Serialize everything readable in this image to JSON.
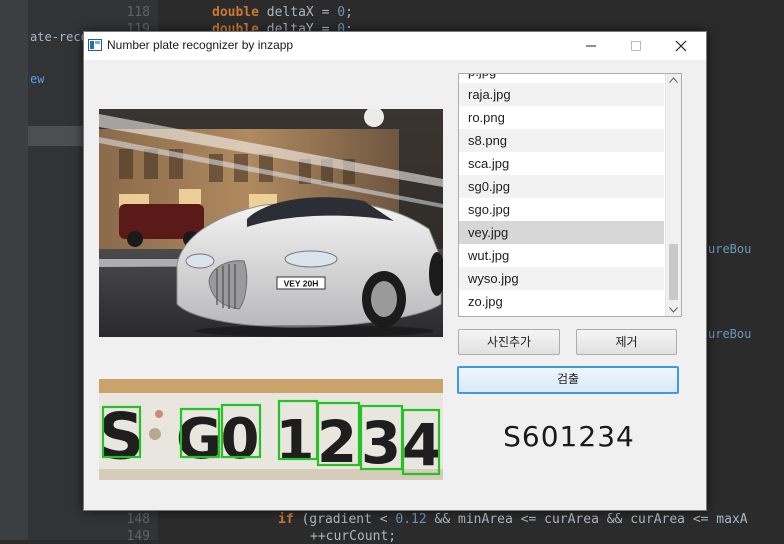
{
  "ide": {
    "line_numbers": [
      "118",
      "119",
      "148",
      "149"
    ],
    "code_lines": {
      "l118_kw": "double",
      "l118_rest": " deltaX = ",
      "l118_num": "0",
      "l118_end": ";",
      "l119_kw": "double",
      "l119_rest": " deltaY = ",
      "l119_num": "0",
      "l119_end": ";",
      "l148_kw": "if",
      "l148_a": " (gradient < ",
      "l148_num": "0.12",
      "l148_b": " && minArea <= curArea && curArea <= maxA",
      "l149": "++curCount;"
    },
    "project_items": [
      "ate-recog",
      "ew"
    ],
    "right_fragments": [
      "ureBou",
      "ureBou"
    ]
  },
  "window": {
    "title": "Number plate recognizer by inzapp",
    "minimize_label": "—",
    "maximize_label": "☐",
    "close_label": "✕"
  },
  "file_list": {
    "items": [
      "p.jpg",
      "raja.jpg",
      "ro.png",
      "s8.png",
      "sca.jpg",
      "sg0.jpg",
      "sgo.jpg",
      "vey.jpg",
      "wut.jpg",
      "wyso.jpg",
      "zo.jpg"
    ],
    "selected": "vey.jpg"
  },
  "buttons": {
    "add_photo": "사진추가",
    "remove": "제거",
    "detect": "검출"
  },
  "image": {
    "car_plate_text": "VEY 20H"
  },
  "plate_crop": {
    "characters": [
      "S",
      "G",
      "0",
      "1",
      "2",
      "3",
      "4"
    ]
  },
  "result_text": "S601234",
  "colors": {
    "detect_box": "#25c225",
    "focus_border": "#3c9be1",
    "selected_row": "#d7d7d7"
  }
}
